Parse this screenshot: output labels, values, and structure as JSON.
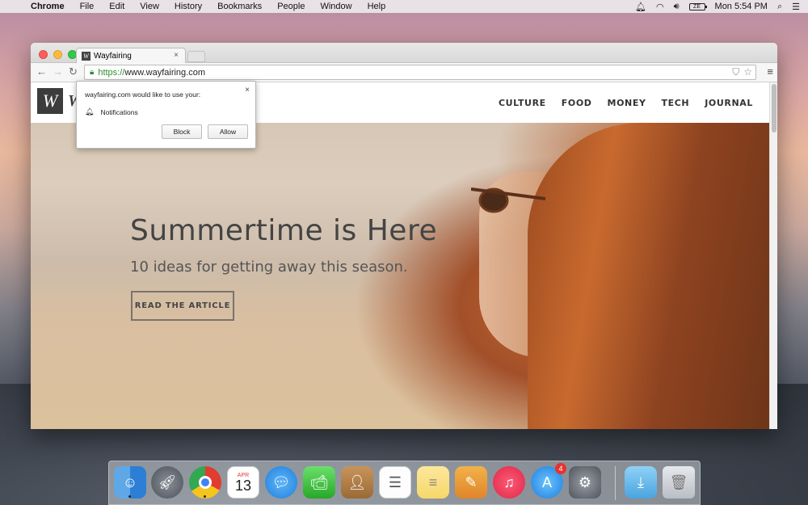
{
  "menubar": {
    "app_name": "Chrome",
    "items": [
      "File",
      "Edit",
      "View",
      "History",
      "Bookmarks",
      "People",
      "Window",
      "Help"
    ],
    "clock": "Mon 5:54 PM",
    "battery_label": "ZE"
  },
  "browser": {
    "tab_title": "Wayfairing",
    "tab_close": "×",
    "url_scheme": "https://",
    "url_host": "www.wayfairing.com"
  },
  "permission": {
    "title": "wayfairing.com would like to use your:",
    "item": "Notifications",
    "block_label": "Block",
    "allow_label": "Allow",
    "close": "×"
  },
  "site": {
    "logo_letter": "W",
    "logo_partial": "W",
    "nav": [
      "CULTURE",
      "FOOD",
      "MONEY",
      "TECH",
      "JOURNAL"
    ],
    "hero_title": "Summertime is Here",
    "hero_subtitle": "10 ideas for getting away this season.",
    "hero_button": "READ THE ARTICLE"
  },
  "dock": {
    "calendar_month": "APR",
    "calendar_day": "13",
    "appstore_badge": "4"
  }
}
